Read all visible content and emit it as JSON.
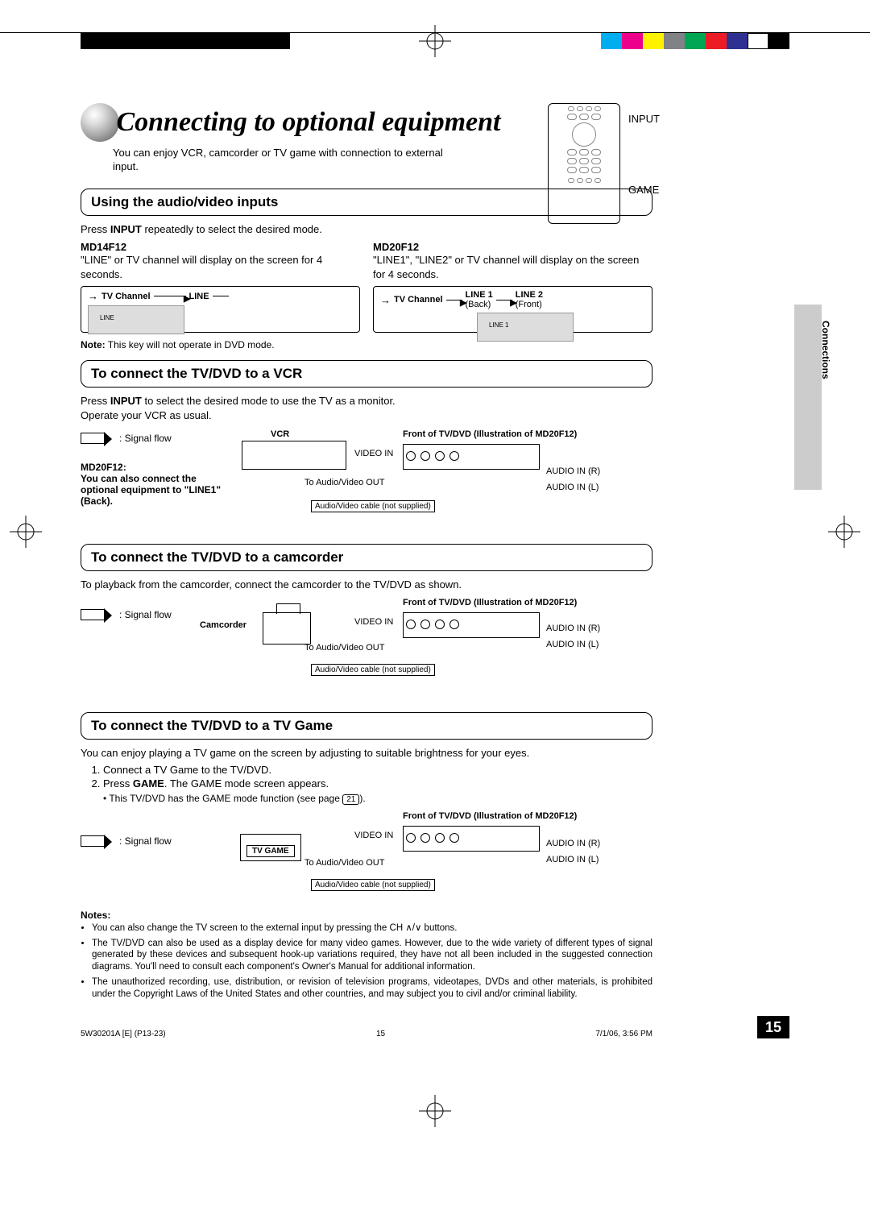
{
  "crop_colors": [
    "#00aeef",
    "#ec008c",
    "#fff200",
    "#808285",
    "#00a651",
    "#ed1c24",
    "#2e3192",
    "#ffffff",
    "#000000"
  ],
  "header": {
    "title": "Connecting to optional equipment",
    "intro": "You can enjoy VCR, camcorder or TV game with connection to external input.",
    "remote_label_input": "INPUT",
    "remote_label_game": "GAME"
  },
  "side_tab": "Connections",
  "sections": {
    "audio_video": {
      "heading": "Using the audio/video inputs",
      "line1_pre": "Press ",
      "line1_bold": "INPUT",
      "line1_post": " repeatedly to select the desired mode.",
      "md14": {
        "model": "MD14F12",
        "desc": "\"LINE\" or TV channel will display on the screen for 4 seconds.",
        "cycle_a": "TV Channel",
        "cycle_b": "LINE",
        "screen_text": "LINE"
      },
      "md20": {
        "model": "MD20F12",
        "desc": "\"LINE1\", \"LINE2\" or TV channel will display on the screen for 4 seconds.",
        "cycle_a": "TV Channel",
        "cycle_b": "LINE 1",
        "cycle_b_sub": "(Back)",
        "cycle_c": "LINE 2",
        "cycle_c_sub": "(Front)",
        "screen_text": "LINE 1"
      },
      "note_pre": "Note:",
      "note_text": " This key will not operate in DVD mode."
    },
    "vcr": {
      "heading": "To connect the TV/DVD to a VCR",
      "line1_pre": "Press ",
      "line1_bold": "INPUT",
      "line1_post": " to select the desired mode to use the TV as a monitor.",
      "line2": "Operate your VCR as usual.",
      "signal_flow": ": Signal flow",
      "device_label": "VCR",
      "front_caption": "Front of TV/DVD (Illustration of MD20F12)",
      "video_in": "VIDEO IN",
      "audio_r": "AUDIO IN (R)",
      "audio_l": "AUDIO IN (L)",
      "to_av": "To Audio/Video OUT",
      "cable": "Audio/Video cable (not supplied)",
      "md20_note_hd": "MD20F12:",
      "md20_note": "You can also connect the optional equipment to \"LINE1\" (Back)."
    },
    "cam": {
      "heading": "To connect the TV/DVD to a camcorder",
      "line1": "To playback from the camcorder, connect the camcorder to the TV/DVD as shown.",
      "signal_flow": ": Signal flow",
      "device_label": "Camcorder",
      "front_caption": "Front of TV/DVD (Illustration of MD20F12)",
      "video_in": "VIDEO IN",
      "audio_r": "AUDIO IN (R)",
      "audio_l": "AUDIO IN (L)",
      "to_av": "To Audio/Video OUT",
      "cable": "Audio/Video cable (not supplied)"
    },
    "game": {
      "heading": "To connect the TV/DVD to a TV Game",
      "line1": "You can enjoy playing a TV game on the screen by adjusting to suitable brightness for your eyes.",
      "step1": "Connect a TV Game to the TV/DVD.",
      "step2_pre": "Press ",
      "step2_bold": "GAME",
      "step2_post": ". The GAME mode screen appears.",
      "sub_bullet_pre": "• This TV/DVD has the GAME mode function (see page ",
      "sub_bullet_ref": "21",
      "sub_bullet_post": ").",
      "signal_flow": ": Signal flow",
      "device_label": "TV GAME",
      "front_caption": "Front of TV/DVD (Illustration of MD20F12)",
      "video_in": "VIDEO IN",
      "audio_r": "AUDIO IN (R)",
      "audio_l": "AUDIO IN (L)",
      "to_av": "To Audio/Video OUT",
      "cable": "Audio/Video cable (not supplied)"
    }
  },
  "notes": {
    "heading": "Notes:",
    "items": [
      "You can also change the TV screen to the external input by pressing the CH ∧/∨ buttons.",
      "The TV/DVD can also be used as a display device for many video games. However, due to the wide variety of different types of signal generated by these devices and subsequent hook-up variations required, they have not all been included in the suggested connection diagrams. You'll need to consult each component's Owner's Manual for additional information.",
      "The unauthorized recording, use, distribution, or revision of television programs, videotapes, DVDs and other materials, is prohibited under the Copyright Laws of the United States and other countries, and may subject you to civil and/or criminal liability."
    ]
  },
  "page_number": "15",
  "footer": {
    "left": "5W30201A [E] (P13-23)",
    "center": "15",
    "right": "7/1/06, 3:56 PM"
  }
}
